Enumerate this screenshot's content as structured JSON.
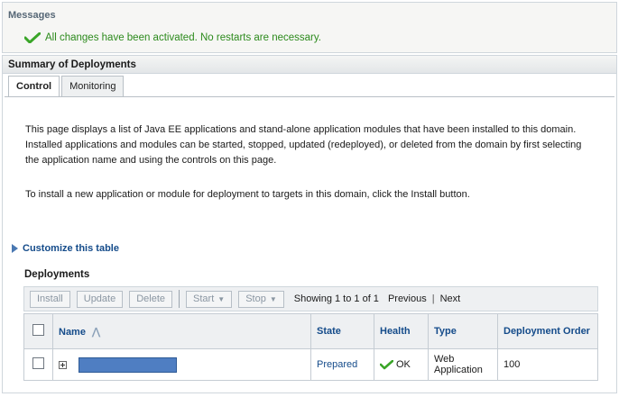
{
  "messages": {
    "title": "Messages",
    "success_text": "All changes have been activated. No restarts are necessary.",
    "success_icon": "checkmark-icon",
    "success_color": "#2c8a1c"
  },
  "summary": {
    "title": "Summary of Deployments",
    "tabs": [
      {
        "label": "Control",
        "active": true
      },
      {
        "label": "Monitoring",
        "active": false
      }
    ],
    "description_1": "This page displays a list of Java EE applications and stand-alone application modules that have been installed to this domain. Installed applications and modules can be started, stopped, updated (redeployed), or deleted from the domain by first selecting the application name and using the controls on this page.",
    "description_2": "To install a new application or module for deployment to targets in this domain, click the Install button.",
    "customize_label": "Customize this table"
  },
  "deployments": {
    "title": "Deployments",
    "toolbar": {
      "install": "Install",
      "update": "Update",
      "delete": "Delete",
      "start": "Start",
      "stop": "Stop",
      "showing": "Showing 1 to 1 of 1",
      "previous": "Previous",
      "next": "Next"
    },
    "columns": {
      "name": "Name",
      "state": "State",
      "health": "Health",
      "type": "Type",
      "order": "Deployment Order"
    },
    "rows": [
      {
        "name": "",
        "state": "Prepared",
        "health": "OK",
        "type": "Web Application",
        "order": "100"
      }
    ]
  },
  "colors": {
    "link": "#144b8a",
    "success": "#2c8a1c",
    "redacted": "#4f7ec2"
  }
}
